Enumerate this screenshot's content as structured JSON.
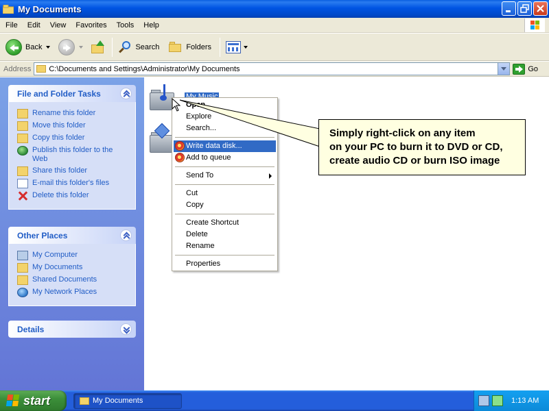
{
  "window": {
    "title": "My Documents",
    "buttons": [
      "minimize",
      "maximize",
      "close"
    ]
  },
  "menubar": {
    "items": [
      "File",
      "Edit",
      "View",
      "Favorites",
      "Tools",
      "Help"
    ]
  },
  "toolbar": {
    "back_label": "Back",
    "search_label": "Search",
    "folders_label": "Folders"
  },
  "address": {
    "label": "Address",
    "value": "C:\\Documents and Settings\\Administrator\\My Documents",
    "go_label": "Go"
  },
  "left_pane": {
    "tasks": {
      "title": "File and Folder Tasks",
      "items": [
        {
          "label": "Rename this folder",
          "icon": "rename-icon"
        },
        {
          "label": "Move this folder",
          "icon": "move-folder-icon"
        },
        {
          "label": "Copy this folder",
          "icon": "copy-folder-icon"
        },
        {
          "label": "Publish this folder to the Web",
          "icon": "globe-icon"
        },
        {
          "label": "Share this folder",
          "icon": "share-folder-icon"
        },
        {
          "label": "E-mail this folder's files",
          "icon": "mail-icon"
        },
        {
          "label": "Delete this folder",
          "icon": "delete-icon"
        }
      ]
    },
    "other_places": {
      "title": "Other Places",
      "items": [
        {
          "label": "My Computer",
          "icon": "computer-icon"
        },
        {
          "label": "My Documents",
          "icon": "documents-folder-icon"
        },
        {
          "label": "Shared Documents",
          "icon": "shared-folder-icon"
        },
        {
          "label": "My Network Places",
          "icon": "network-icon"
        }
      ]
    },
    "details": {
      "title": "Details"
    }
  },
  "content": {
    "items": [
      {
        "label": "My Music",
        "selected": true,
        "icon": "music-folder-icon"
      },
      {
        "label": "",
        "selected": false,
        "icon": "pictures-folder-icon"
      }
    ]
  },
  "context_menu": {
    "items": [
      {
        "label": "Open",
        "bold": true
      },
      {
        "label": "Explore"
      },
      {
        "label": "Search..."
      },
      {
        "label": "Write data disk...",
        "highlighted": true,
        "icon": "burn-disc-icon"
      },
      {
        "label": "Add to queue",
        "icon": "burn-disc-icon"
      },
      {
        "label": "Send To",
        "submenu": true
      },
      {
        "label": "Cut"
      },
      {
        "label": "Copy"
      },
      {
        "label": "Create Shortcut"
      },
      {
        "label": "Delete"
      },
      {
        "label": "Rename"
      },
      {
        "label": "Properties"
      }
    ]
  },
  "callout": {
    "lines": [
      "Simply right-click on any item",
      "on your PC to burn it to DVD or CD,",
      "create audio CD or burn ISO image"
    ]
  },
  "taskbar": {
    "start_label": "start",
    "task_label": "My Documents",
    "clock": "1:13 AM"
  },
  "colors": {
    "accent": "#316ac5",
    "titlebar": "#0054e3",
    "link": "#215dc6",
    "taskbar": "#245edb",
    "start_button": "#3c8f3a",
    "callout_bg": "#ffffe1"
  }
}
